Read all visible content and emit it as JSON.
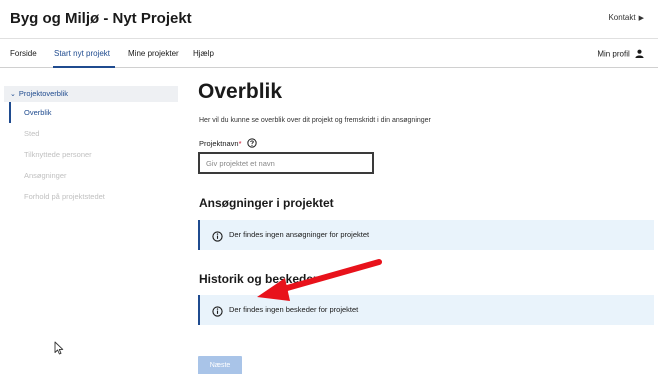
{
  "header": {
    "app_title": "Byg og Miljø - Nyt Projekt",
    "contact_label": "Kontakt"
  },
  "nav": {
    "items": [
      {
        "label": "Forside"
      },
      {
        "label": "Start nyt projekt",
        "active": true
      },
      {
        "label": "Mine projekter"
      },
      {
        "label": "Hjælp"
      }
    ],
    "profile_label": "Min profil"
  },
  "sidebar": {
    "section_label": "Projektoverblik",
    "items": [
      {
        "label": "Overblik",
        "active": true
      },
      {
        "label": "Sted"
      },
      {
        "label": "Tilknyttede personer"
      },
      {
        "label": "Ansøgninger"
      },
      {
        "label": "Forhold på projektstedet"
      }
    ]
  },
  "main": {
    "title": "Overblik",
    "intro": "Her vil du kunne se overblik over dit projekt og fremskridt i din ansøgninger",
    "project_name": {
      "label": "Projektnavn",
      "required_mark": "*",
      "value": "",
      "placeholder": "Giv projektet et navn"
    },
    "applications": {
      "title": "Ansøgninger i projektet",
      "empty_text": "Der findes ingen ansøgninger for projektet"
    },
    "history": {
      "title": "Historik og beskeder",
      "empty_text": "Der findes ingen beskeder for projektet"
    },
    "next_label": "Næste"
  },
  "colors": {
    "accent": "#1f4b8f",
    "info_bg": "#e9f3fb",
    "required": "#c8102e",
    "annotation_arrow": "#e8121b",
    "next_disabled": "#a9c4e8"
  }
}
